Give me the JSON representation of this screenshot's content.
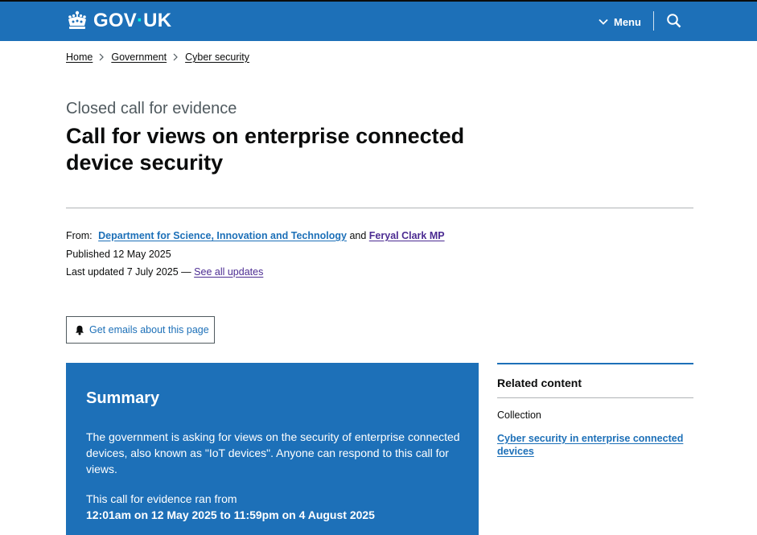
{
  "header": {
    "logo_text_left": "GOV",
    "logo_dot": "·",
    "logo_text_right": "UK",
    "menu_label": "Menu",
    "colors": {
      "brand": "#1d70b8",
      "header_text": "#ffffff",
      "logo_dot": "#00ffe0"
    },
    "icons": [
      "crown-icon",
      "chevron-down-icon",
      "search-icon"
    ]
  },
  "breadcrumb": {
    "items": [
      {
        "label": "Home"
      },
      {
        "label": "Government"
      },
      {
        "label": "Cyber security"
      }
    ],
    "separator_icon": "chevron-right-icon"
  },
  "page": {
    "caption": "Closed call for evidence",
    "title": "Call for views on enterprise connected device security"
  },
  "metadata": {
    "from_label": "From:",
    "org_link": "Department for Science, Innovation and Technology",
    "and_text": "and",
    "person_link": "Feryal Clark MP",
    "published": "Published 12 May 2025",
    "last_updated": "Last updated 7 July 2025 —",
    "see_all_updates": "See all updates",
    "colors": {
      "link": "#1d70b8",
      "visited_link": "#4c2c92"
    }
  },
  "email_signup": {
    "label": "Get emails about this page",
    "icon": "bell-icon"
  },
  "summary": {
    "heading": "Summary",
    "description": "The government is asking for views on the security of enterprise connected devices, also known as \"IoT devices\". Anyone can respond to this call for views.",
    "ran_label": "This call for evidence ran from",
    "dates": "12:01am on 12 May 2025 to 11:59pm on 4 August 2025",
    "background": "#1d70b8"
  },
  "related": {
    "heading": "Related content",
    "collection_label": "Collection",
    "collection_link": "Cyber security in enterprise connected devices"
  }
}
